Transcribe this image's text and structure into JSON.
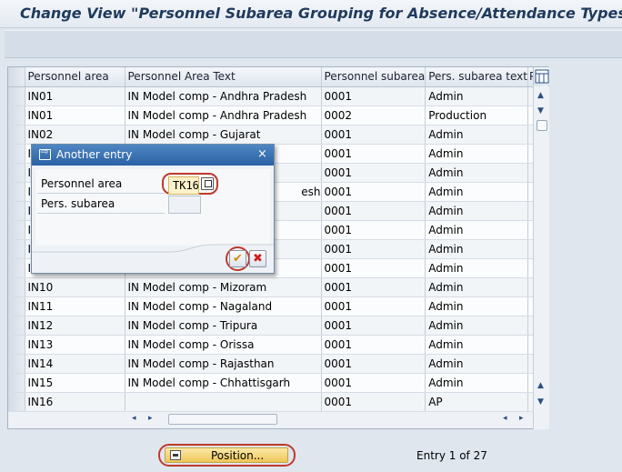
{
  "title": "Change View \"Personnel Subarea Grouping for Absence/Attendance Types\":",
  "table": {
    "columns": [
      "Personnel area",
      "Personnel Area Text",
      "Personnel subarea",
      "Pers. subarea text",
      "P:"
    ],
    "rows": [
      {
        "area": "IN01",
        "text": "IN Model comp - Andhra Pradesh",
        "subarea": "0001",
        "subtext": "Admin"
      },
      {
        "area": "IN01",
        "text": "IN Model comp - Andhra Pradesh",
        "subarea": "0002",
        "subtext": "Production"
      },
      {
        "area": "IN02",
        "text": "IN Model comp - Gujarat",
        "subarea": "0001",
        "subtext": "Admin"
      },
      {
        "area": "I",
        "text": "",
        "subarea": "0001",
        "subtext": "Admin"
      },
      {
        "area": "I",
        "text": "",
        "subarea": "0001",
        "subtext": "Admin"
      },
      {
        "area": "I",
        "text": "esh",
        "subarea": "0001",
        "subtext": "Admin"
      },
      {
        "area": "I",
        "text": "",
        "subarea": "0001",
        "subtext": "Admin"
      },
      {
        "area": "I",
        "text": "",
        "subarea": "0001",
        "subtext": "Admin"
      },
      {
        "area": "I",
        "text": "",
        "subarea": "0001",
        "subtext": "Admin"
      },
      {
        "area": "I",
        "text": "",
        "subarea": "0001",
        "subtext": "Admin"
      },
      {
        "area": "IN10",
        "text": "IN Model comp - Mizoram",
        "subarea": "0001",
        "subtext": "Admin"
      },
      {
        "area": "IN11",
        "text": "IN Model comp - Nagaland",
        "subarea": "0001",
        "subtext": "Admin"
      },
      {
        "area": "IN12",
        "text": "IN Model comp - Tripura",
        "subarea": "0001",
        "subtext": "Admin"
      },
      {
        "area": "IN13",
        "text": "IN Model comp - Orissa",
        "subarea": "0001",
        "subtext": "Admin"
      },
      {
        "area": "IN14",
        "text": "IN Model comp - Rajasthan",
        "subarea": "0001",
        "subtext": "Admin"
      },
      {
        "area": "IN15",
        "text": "IN Model comp - Chhattisgarh",
        "subarea": "0001",
        "subtext": "Admin"
      },
      {
        "area": "IN16",
        "text": "",
        "subarea": "0001",
        "subtext": "AP"
      }
    ]
  },
  "position_button": "Position...",
  "entry_info": "Entry 1 of 27",
  "dialog": {
    "title": "Another entry",
    "personnel_area_label": "Personnel area",
    "personnel_area_value": "TK16",
    "pers_subarea_label": "Pers. subarea",
    "pers_subarea_value": "",
    "close_symbol": "×",
    "ok_symbol": "✔",
    "cancel_symbol": "✖"
  },
  "colors": {
    "accent": "#2a61a3",
    "highlight": "#c0392b"
  }
}
